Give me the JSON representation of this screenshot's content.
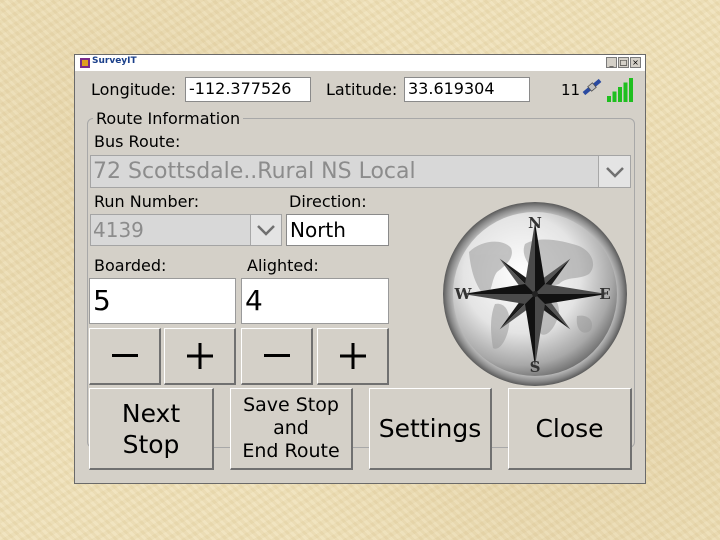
{
  "window": {
    "title": "SurveyIT",
    "controls": {
      "minimize": "_",
      "maximize": "□",
      "close": "×"
    }
  },
  "gps": {
    "longitude_label": "Longitude:",
    "longitude_value": "-112.377526",
    "latitude_label": "Latitude:",
    "latitude_value": "33.619304",
    "satellite_count": "11",
    "signal_bars": 5,
    "signal_color": "#1fbf1f"
  },
  "route_info": {
    "group_title": "Route Information",
    "bus_route_label": "Bus Route:",
    "bus_route_value": "72 Scottsdale..Rural NS Local",
    "run_number_label": "Run Number:",
    "run_number_value": "4139",
    "direction_label": "Direction:",
    "direction_value": "North",
    "boarded_label": "Boarded:",
    "boarded_value": "5",
    "alighted_label": "Alighted:",
    "alighted_value": "4"
  },
  "steppers": {
    "minus": "−",
    "plus": "+"
  },
  "compass": {
    "north": "N",
    "south": "S",
    "east": "E",
    "west": "W"
  },
  "actions": {
    "next_stop": "Next\nStop",
    "save_stop": "Save Stop\nand\nEnd Route",
    "settings": "Settings",
    "close": "Close"
  }
}
